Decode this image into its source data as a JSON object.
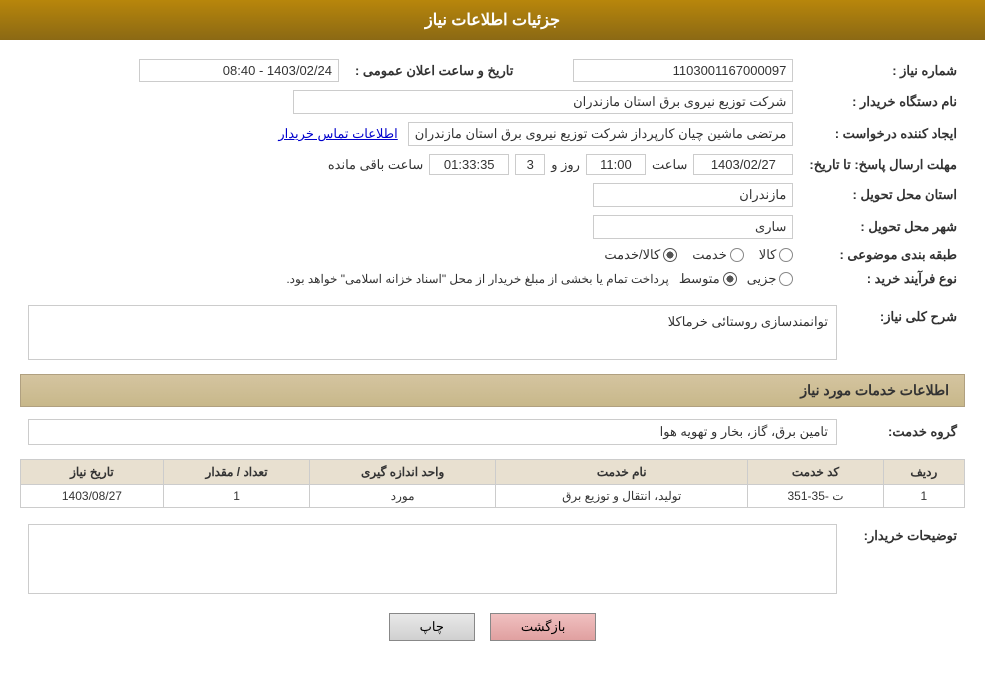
{
  "header": {
    "title": "جزئیات اطلاعات نیاز"
  },
  "fields": {
    "shomareNiaz_label": "شماره نیاز :",
    "shomareNiaz_value": "1103001167000097",
    "namDastgah_label": "نام دستگاه خریدار :",
    "namDastgah_value": "شرکت توزیع نیروی برق استان مازندران",
    "ijadKonande_label": "ایجاد کننده درخواست :",
    "ijadKonande_value": "مرتضی ماشین چیان کارپرداز شرکت توزیع نیروی برق استان مازندران",
    "ijadKonande_link": "اطلاعات تماس خریدار",
    "mohlat_label": "مهلت ارسال پاسخ: تا تاریخ:",
    "mohlat_date": "1403/02/27",
    "mohlat_saat_label": "ساعت",
    "mohlat_saat_value": "11:00",
    "mohlat_roz_label": "روز و",
    "mohlat_roz_value": "3",
    "mohlat_mande_value": "01:33:35",
    "mohlat_mande_label": "ساعت باقی مانده",
    "ostan_label": "استان محل تحویل :",
    "ostan_value": "مازندران",
    "shahr_label": "شهر محل تحویل :",
    "shahr_value": "ساری",
    "tabaqe_label": "طبقه بندی موضوعی :",
    "tabaqe_kala": "کالا",
    "tabaqe_khedmat": "خدمت",
    "tabaqe_kala_khedmat": "کالا/خدمت",
    "noefarayand_label": "نوع فرآیند خرید :",
    "noefarayand_jozyi": "جزیی",
    "noefarayand_motawaset": "متوسط",
    "noefarayand_text": "پرداخت تمام یا بخشی از مبلغ خریدار از محل \"اسناد خزانه اسلامی\" خواهد بود.",
    "tarikhAlan_label": "تاریخ و ساعت اعلان عمومی :",
    "tarikhAlan_value": "1403/02/24 - 08:40",
    "sharhKoli_label": "شرح کلی نیاز:",
    "sharhKoli_value": "توانمندسازی روستائی خرماکلا",
    "khadamat_section_title": "اطلاعات خدمات مورد نیاز",
    "goroh_label": "گروه خدمت:",
    "goroh_value": "تامین برق، گاز، بخار و تهویه هوا",
    "table_headers": {
      "radif": "ردیف",
      "kod": "کد خدمت",
      "nam": "نام خدمت",
      "vahed": "واحد اندازه گیری",
      "tedad": "تعداد / مقدار",
      "tarikh": "تاریخ نیاز"
    },
    "table_rows": [
      {
        "radif": "1",
        "kod": "ت -35-351",
        "nam": "تولید، انتقال و توزیع برق",
        "vahed": "مورد",
        "tedad": "1",
        "tarikh": "1403/08/27"
      }
    ],
    "tozihat_label": "توضیحات خریدار:",
    "buttons": {
      "back": "بازگشت",
      "print": "چاپ"
    }
  }
}
